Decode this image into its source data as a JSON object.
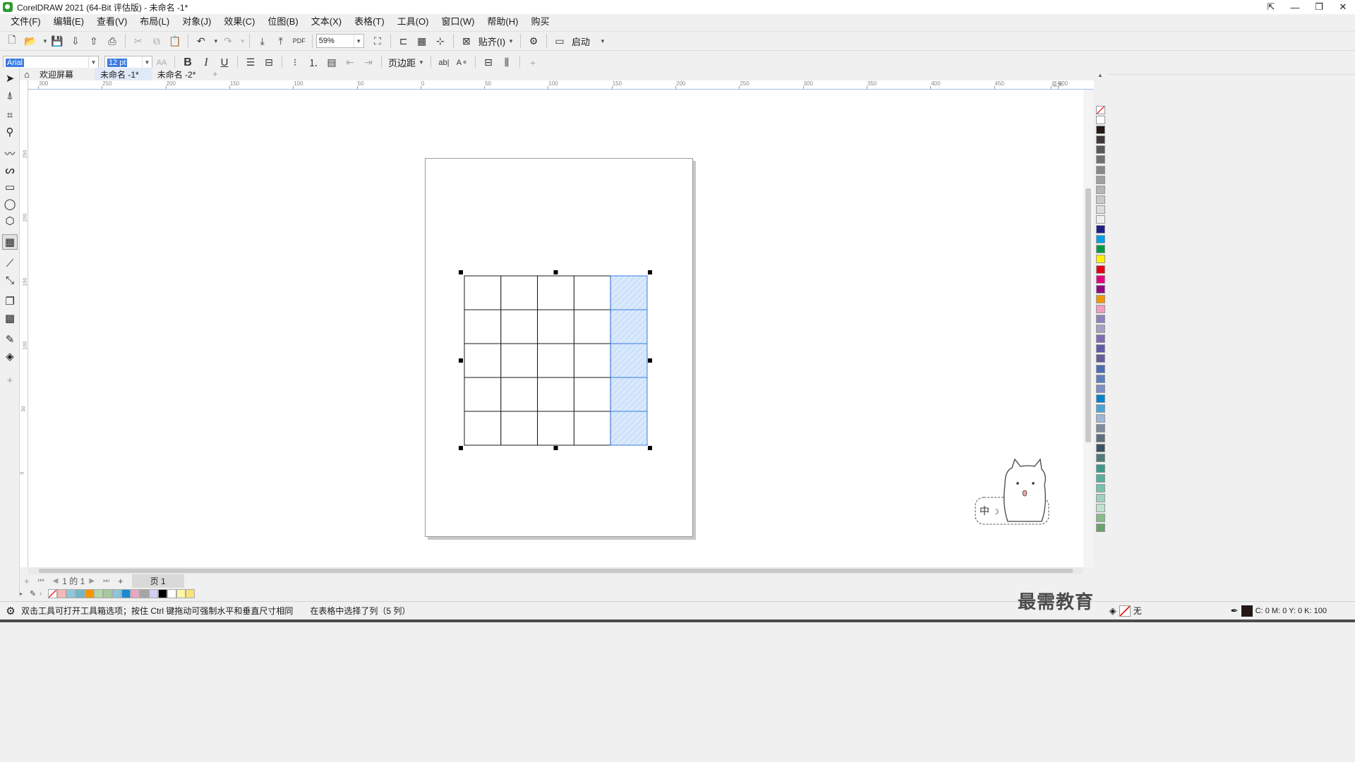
{
  "titlebar": {
    "title": "CorelDRAW 2021 (64-Bit 评估版) - 未命名 -1*",
    "buttons": [
      "⇱",
      "—",
      "❐",
      "✕"
    ]
  },
  "menubar": [
    "文件(F)",
    "编辑(E)",
    "查看(V)",
    "布局(L)",
    "对象(J)",
    "效果(C)",
    "位图(B)",
    "文本(X)",
    "表格(T)",
    "工具(O)",
    "窗口(W)",
    "帮助(H)",
    "购买"
  ],
  "toolbar1": {
    "zoom": "59%",
    "snap_label": "贴齐(I)",
    "launch_label": "启动"
  },
  "toolbar2": {
    "font_name": "Arial",
    "font_size": "12 pt",
    "bold": "B",
    "italic": "I",
    "underline": "U",
    "margin_label": "页边距"
  },
  "doctabs": [
    "欢迎屏幕",
    "未命名 -1*",
    "未命名 -2*"
  ],
  "doctab_add": "+",
  "hruler_labels": [
    "300",
    "250",
    "200",
    "150",
    "100",
    "50",
    "0",
    "50",
    "100",
    "150",
    "200",
    "250",
    "300",
    "350",
    "400",
    "450",
    "500",
    "毫米"
  ],
  "vruler_labels": [
    "250",
    "200",
    "150",
    "100",
    "50",
    "0"
  ],
  "table": {
    "rows": 5,
    "cols": 5,
    "selected_column": 5,
    "selection_color": "#cfe3fb"
  },
  "pagenav": {
    "position": "1 的 1",
    "page_tab": "页 1"
  },
  "status": {
    "hint": "双击工具可打开工具箱选项；按住 Ctrl 键拖动可强制水平和垂直尺寸相同",
    "selection": "在表格中选择了列（5 列）",
    "fill_label": "无",
    "color_readout": "C: 0 M: 0 Y: 0 K: 100"
  },
  "watermark": "最需教育",
  "colors": {
    "accent": "#3a7be0",
    "table_line": "#1a1a1a",
    "selection_border": "#3a7be0"
  },
  "palette_colors": [
    "#ffffff",
    "#231815",
    "#3e3a39",
    "#595757",
    "#727171",
    "#898989",
    "#9fa0a0",
    "#b5b5b6",
    "#c9caca",
    "#dcdddd",
    "#efefef",
    "#1d2088",
    "#00a0e9",
    "#009944",
    "#fff100",
    "#e60012",
    "#e4007f",
    "#920783",
    "#f39800",
    "#f19ec2",
    "#8f82bc",
    "#a4a0c4",
    "#7d6bb3",
    "#605ca8",
    "#6a5b9d",
    "#4c6cb3",
    "#5f7fc1",
    "#7b8fc8",
    "#0081cc",
    "#4aa5d8",
    "#9bb8d3",
    "#7a8c9e",
    "#5d6e80",
    "#3f5266",
    "#4c7d7a",
    "#3c9a8b",
    "#58b09c",
    "#78c2ad",
    "#9fd2bd",
    "#c1e2cf",
    "#88bb88",
    "#6aa36a"
  ],
  "docpalette_colors": [
    "#f3b9b9",
    "#8fc8d8",
    "#6fb7c9",
    "#f39800",
    "#b5d6a6",
    "#a7c8a0",
    "#89c6d9",
    "#1e88d3",
    "#e5a9c0",
    "#a5a5a5",
    "#d0d0ef",
    "#000000",
    "#ffffff",
    "#fff6a6",
    "#f7e27c"
  ]
}
